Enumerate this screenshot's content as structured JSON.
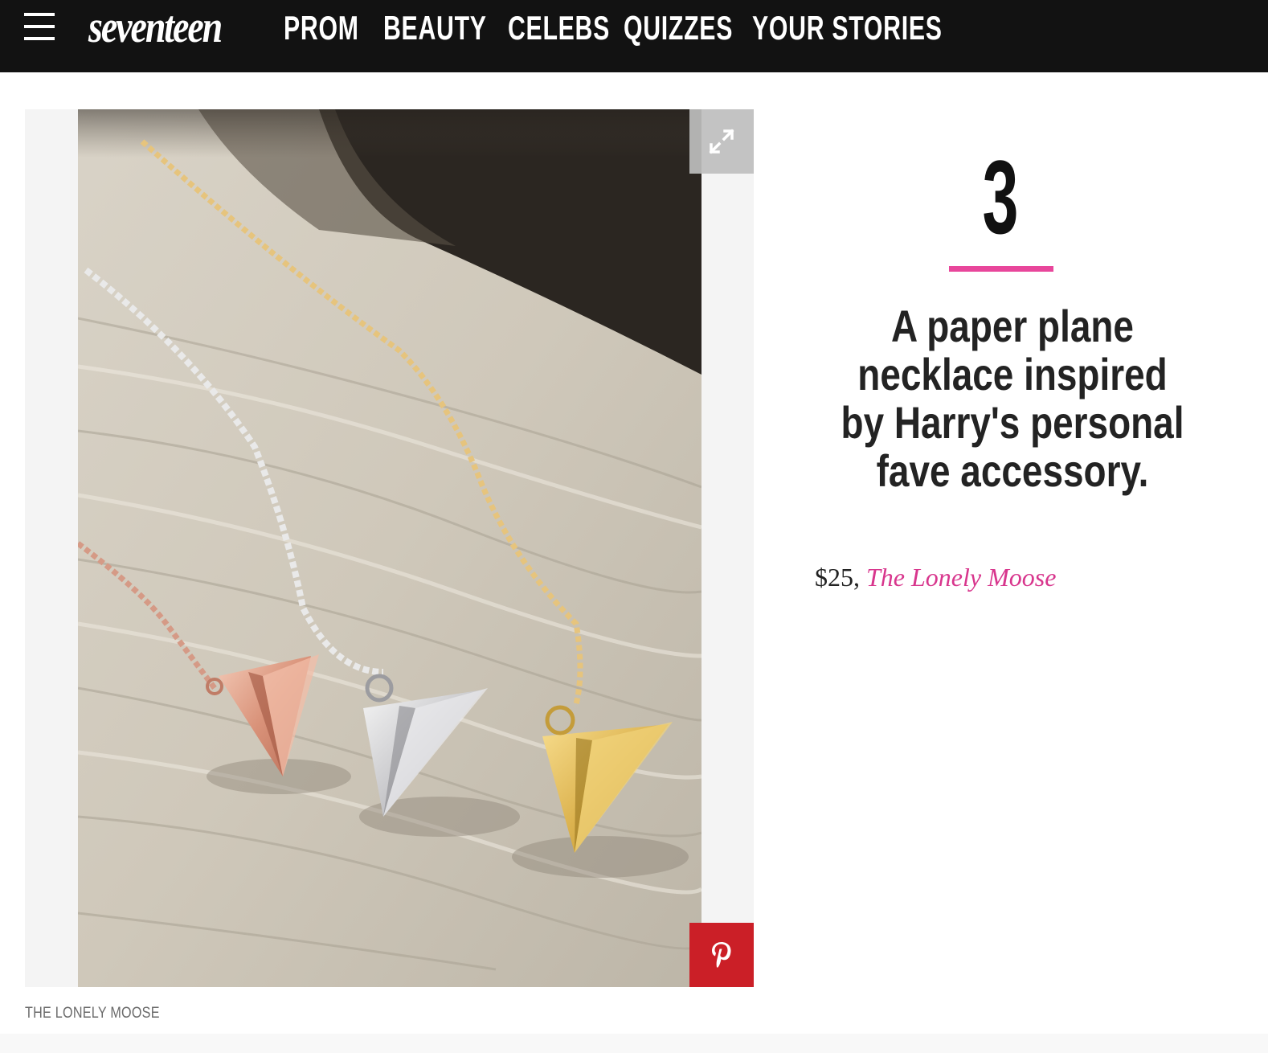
{
  "nav": {
    "brand": "seventeen",
    "links": [
      "PROM",
      "BEAUTY",
      "CELEBS",
      "QUIZZES",
      "YOUR STORIES"
    ]
  },
  "slide": {
    "number": "3",
    "headline": "A paper plane necklace inspired by Harry's personal fave accessory.",
    "price": "$25, ",
    "shop": "The Lonely Moose",
    "image_caption": "THE LONELY MOOSE"
  },
  "colors": {
    "accent_pink": "#e8469b",
    "pinterest_red": "#cb1f27",
    "nav_bg": "#121212"
  },
  "icons": {
    "menu": "hamburger-icon",
    "expand": "expand-icon",
    "pinterest": "pinterest-icon"
  }
}
